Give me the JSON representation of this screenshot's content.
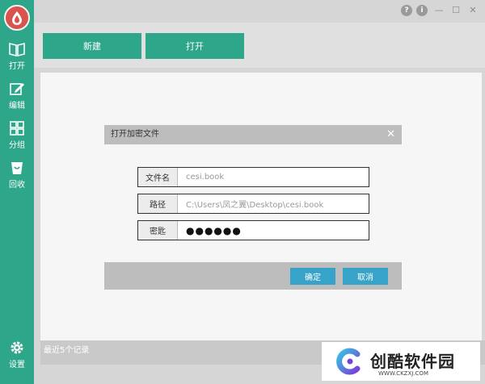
{
  "window_controls": {
    "help": "?",
    "info": "i",
    "minimize": "—",
    "maximize": "☐",
    "close": "✕"
  },
  "sidebar": {
    "items": [
      {
        "label": "打开",
        "icon": "book-icon"
      },
      {
        "label": "编辑",
        "icon": "edit-icon"
      },
      {
        "label": "分组",
        "icon": "grid-icon"
      },
      {
        "label": "回收",
        "icon": "trash-icon"
      }
    ],
    "settings_label": "设置"
  },
  "toolbar": {
    "new_label": "新建",
    "open_label": "打开"
  },
  "dialog": {
    "title": "打开加密文件",
    "close": "✕",
    "filename_label": "文件名",
    "filename_value": "cesi.book",
    "path_label": "路径",
    "path_value": "C:\\Users\\凤之翼\\Desktop\\cesi.book",
    "password_label": "密匙",
    "password_value": "●●●●●●",
    "confirm_label": "确定",
    "cancel_label": "取消"
  },
  "status": {
    "recent_text": "最近5个记录"
  },
  "watermark": {
    "title": "创酷软件园",
    "url": "WWW.CKZXJ.COM"
  },
  "colors": {
    "accent": "#2ea68a",
    "dialog_button": "#38a3c8",
    "logo": "#d9534f"
  }
}
